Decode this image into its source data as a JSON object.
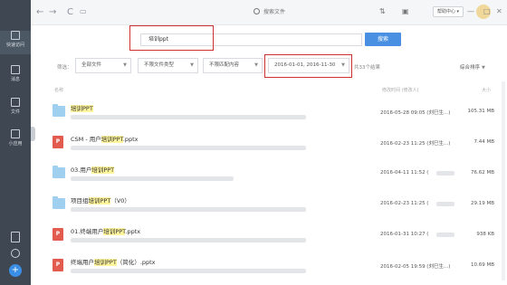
{
  "sidebar": {
    "items": [
      {
        "label": "快速访问",
        "icon": "quick-access-icon"
      },
      {
        "label": "消息",
        "icon": "message-icon"
      },
      {
        "label": "文件",
        "icon": "file-icon"
      },
      {
        "label": "小应用",
        "icon": "app-icon"
      }
    ],
    "add_label": "+"
  },
  "topbar": {
    "back": "←",
    "forward": "→",
    "refresh": "C",
    "search_label": "搜索文件",
    "help_label": "帮助中心",
    "minimize": "—",
    "maximize": "□",
    "close": "✕"
  },
  "search": {
    "value": "培训ppt",
    "button_label": "搜索"
  },
  "filters": {
    "label": "筛选：",
    "type": "全部文件",
    "file_type": "不限文件类型",
    "match": "不限匹配内容",
    "date_range": "2016-01-01, 2016-11-30",
    "result_count": "共33个结果",
    "sort": "综合排序"
  },
  "columns": {
    "name": "名称",
    "modified": "修改时间 (修改人)",
    "size": "大小"
  },
  "files": [
    {
      "kind": "folder",
      "prefix": "",
      "hl": "培训PPT",
      "suffix": "",
      "date": "2016-05-28 09:05 (刘巳生...)",
      "size": "105.31 MB"
    },
    {
      "kind": "ppt",
      "prefix": "CSM - 用户",
      "hl": "培训PPT",
      "suffix": ".pptx",
      "date": "2016-02-23 11:25 (刘巳生...)",
      "size": "7.44 MB"
    },
    {
      "kind": "folder",
      "prefix": "03.用户",
      "hl": "培训PPT",
      "suffix": "",
      "date": "2016-04-11 11:52 (",
      "size": "76.62 MB"
    },
    {
      "kind": "folder",
      "prefix": "项目组",
      "hl": "培训PPT",
      "suffix": "（V0）",
      "date": "2016-02-23 11:25 (",
      "size": "29.19 MB"
    },
    {
      "kind": "ppt",
      "prefix": "01.终端用户",
      "hl": "培训PPT",
      "suffix": ".pptx",
      "date": "2016-01-31 10:27 (",
      "size": "938 KB"
    },
    {
      "kind": "ppt",
      "prefix": "终端用户",
      "hl": "培训PPT",
      "suffix": "（简化）.pptx",
      "date": "2016-02-05 19:59 (刘巳生...)",
      "size": "10.69 MB"
    }
  ]
}
